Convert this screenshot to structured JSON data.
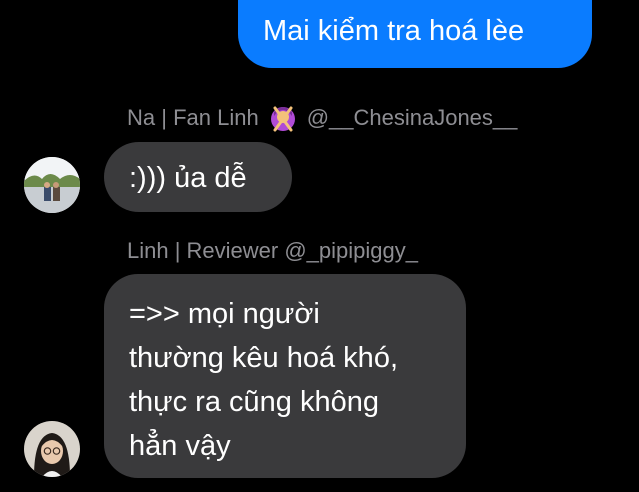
{
  "outgoing": {
    "text": "Mai kiểm tra hoá lèe",
    "color": "#0a7cff"
  },
  "messages": [
    {
      "sender_before": "Na | Fan Linh",
      "sender_after": "@__ChesinaJones__",
      "sender_emoji": "person-gesturing-no-emoji",
      "text": ":))) ủa dễ"
    },
    {
      "sender": "Linh | Reviewer @_pipipiggy_",
      "lines": [
        "=>> mọi người",
        "thường kêu hoá khó,",
        "thực ra cũng không",
        "hẳn vậy"
      ]
    }
  ],
  "colors": {
    "background": "#000000",
    "incoming_bubble": "#3a3a3c",
    "sender_label": "#8e8e93"
  }
}
